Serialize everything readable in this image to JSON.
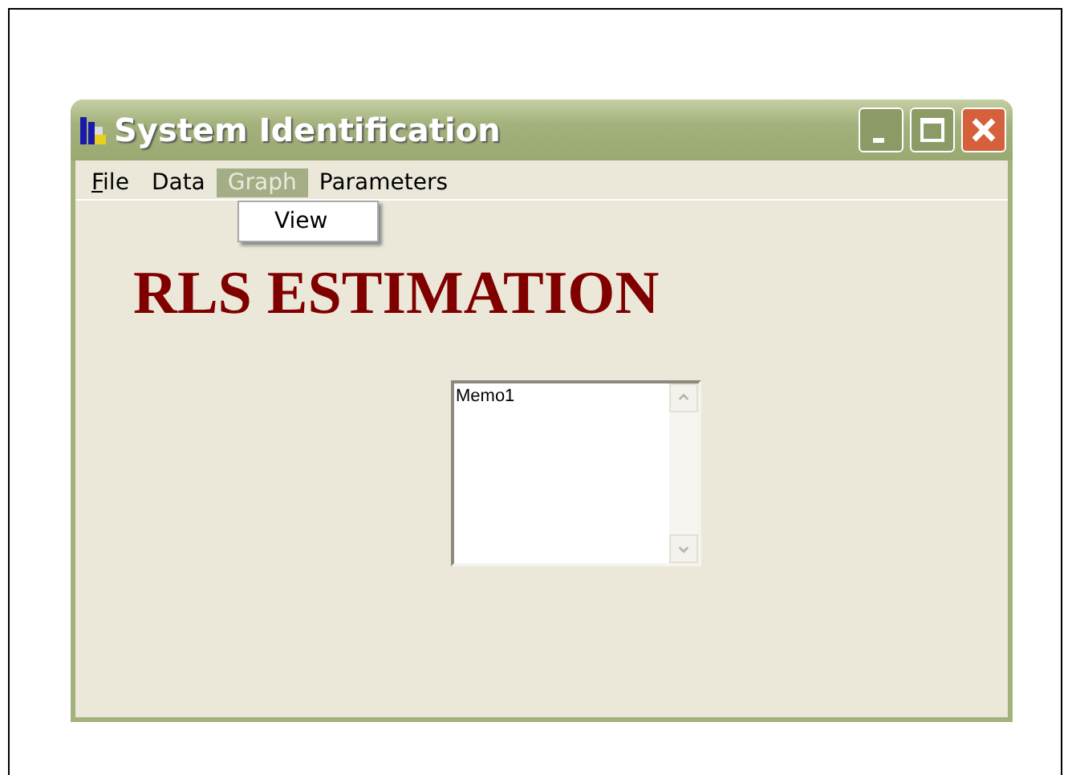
{
  "window": {
    "title": "System Identification"
  },
  "menu": [
    {
      "label": "File",
      "underlined": true,
      "selected": false
    },
    {
      "label": "Data",
      "underlined": false,
      "selected": false
    },
    {
      "label": "Graph",
      "underlined": false,
      "selected": true
    },
    {
      "label": "Parameters",
      "underlined": false,
      "selected": false
    }
  ],
  "dropdown": {
    "items": [
      "View"
    ]
  },
  "heading": "RLS ESTIMATION",
  "memo": {
    "value": "Memo1"
  }
}
